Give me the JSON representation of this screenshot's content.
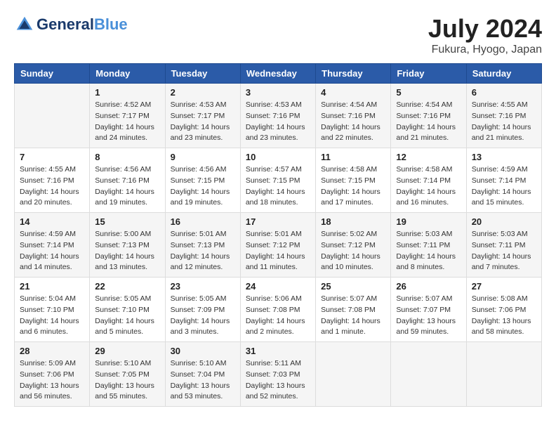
{
  "header": {
    "logo_line1": "General",
    "logo_line2": "Blue",
    "month_year": "July 2024",
    "location": "Fukura, Hyogo, Japan"
  },
  "weekdays": [
    "Sunday",
    "Monday",
    "Tuesday",
    "Wednesday",
    "Thursday",
    "Friday",
    "Saturday"
  ],
  "weeks": [
    [
      {
        "day": "",
        "info": ""
      },
      {
        "day": "1",
        "info": "Sunrise: 4:52 AM\nSunset: 7:17 PM\nDaylight: 14 hours\nand 24 minutes."
      },
      {
        "day": "2",
        "info": "Sunrise: 4:53 AM\nSunset: 7:17 PM\nDaylight: 14 hours\nand 23 minutes."
      },
      {
        "day": "3",
        "info": "Sunrise: 4:53 AM\nSunset: 7:16 PM\nDaylight: 14 hours\nand 23 minutes."
      },
      {
        "day": "4",
        "info": "Sunrise: 4:54 AM\nSunset: 7:16 PM\nDaylight: 14 hours\nand 22 minutes."
      },
      {
        "day": "5",
        "info": "Sunrise: 4:54 AM\nSunset: 7:16 PM\nDaylight: 14 hours\nand 21 minutes."
      },
      {
        "day": "6",
        "info": "Sunrise: 4:55 AM\nSunset: 7:16 PM\nDaylight: 14 hours\nand 21 minutes."
      }
    ],
    [
      {
        "day": "7",
        "info": "Sunrise: 4:55 AM\nSunset: 7:16 PM\nDaylight: 14 hours\nand 20 minutes."
      },
      {
        "day": "8",
        "info": "Sunrise: 4:56 AM\nSunset: 7:16 PM\nDaylight: 14 hours\nand 19 minutes."
      },
      {
        "day": "9",
        "info": "Sunrise: 4:56 AM\nSunset: 7:15 PM\nDaylight: 14 hours\nand 19 minutes."
      },
      {
        "day": "10",
        "info": "Sunrise: 4:57 AM\nSunset: 7:15 PM\nDaylight: 14 hours\nand 18 minutes."
      },
      {
        "day": "11",
        "info": "Sunrise: 4:58 AM\nSunset: 7:15 PM\nDaylight: 14 hours\nand 17 minutes."
      },
      {
        "day": "12",
        "info": "Sunrise: 4:58 AM\nSunset: 7:14 PM\nDaylight: 14 hours\nand 16 minutes."
      },
      {
        "day": "13",
        "info": "Sunrise: 4:59 AM\nSunset: 7:14 PM\nDaylight: 14 hours\nand 15 minutes."
      }
    ],
    [
      {
        "day": "14",
        "info": "Sunrise: 4:59 AM\nSunset: 7:14 PM\nDaylight: 14 hours\nand 14 minutes."
      },
      {
        "day": "15",
        "info": "Sunrise: 5:00 AM\nSunset: 7:13 PM\nDaylight: 14 hours\nand 13 minutes."
      },
      {
        "day": "16",
        "info": "Sunrise: 5:01 AM\nSunset: 7:13 PM\nDaylight: 14 hours\nand 12 minutes."
      },
      {
        "day": "17",
        "info": "Sunrise: 5:01 AM\nSunset: 7:12 PM\nDaylight: 14 hours\nand 11 minutes."
      },
      {
        "day": "18",
        "info": "Sunrise: 5:02 AM\nSunset: 7:12 PM\nDaylight: 14 hours\nand 10 minutes."
      },
      {
        "day": "19",
        "info": "Sunrise: 5:03 AM\nSunset: 7:11 PM\nDaylight: 14 hours\nand 8 minutes."
      },
      {
        "day": "20",
        "info": "Sunrise: 5:03 AM\nSunset: 7:11 PM\nDaylight: 14 hours\nand 7 minutes."
      }
    ],
    [
      {
        "day": "21",
        "info": "Sunrise: 5:04 AM\nSunset: 7:10 PM\nDaylight: 14 hours\nand 6 minutes."
      },
      {
        "day": "22",
        "info": "Sunrise: 5:05 AM\nSunset: 7:10 PM\nDaylight: 14 hours\nand 5 minutes."
      },
      {
        "day": "23",
        "info": "Sunrise: 5:05 AM\nSunset: 7:09 PM\nDaylight: 14 hours\nand 3 minutes."
      },
      {
        "day": "24",
        "info": "Sunrise: 5:06 AM\nSunset: 7:08 PM\nDaylight: 14 hours\nand 2 minutes."
      },
      {
        "day": "25",
        "info": "Sunrise: 5:07 AM\nSunset: 7:08 PM\nDaylight: 14 hours\nand 1 minute."
      },
      {
        "day": "26",
        "info": "Sunrise: 5:07 AM\nSunset: 7:07 PM\nDaylight: 13 hours\nand 59 minutes."
      },
      {
        "day": "27",
        "info": "Sunrise: 5:08 AM\nSunset: 7:06 PM\nDaylight: 13 hours\nand 58 minutes."
      }
    ],
    [
      {
        "day": "28",
        "info": "Sunrise: 5:09 AM\nSunset: 7:06 PM\nDaylight: 13 hours\nand 56 minutes."
      },
      {
        "day": "29",
        "info": "Sunrise: 5:10 AM\nSunset: 7:05 PM\nDaylight: 13 hours\nand 55 minutes."
      },
      {
        "day": "30",
        "info": "Sunrise: 5:10 AM\nSunset: 7:04 PM\nDaylight: 13 hours\nand 53 minutes."
      },
      {
        "day": "31",
        "info": "Sunrise: 5:11 AM\nSunset: 7:03 PM\nDaylight: 13 hours\nand 52 minutes."
      },
      {
        "day": "",
        "info": ""
      },
      {
        "day": "",
        "info": ""
      },
      {
        "day": "",
        "info": ""
      }
    ]
  ]
}
